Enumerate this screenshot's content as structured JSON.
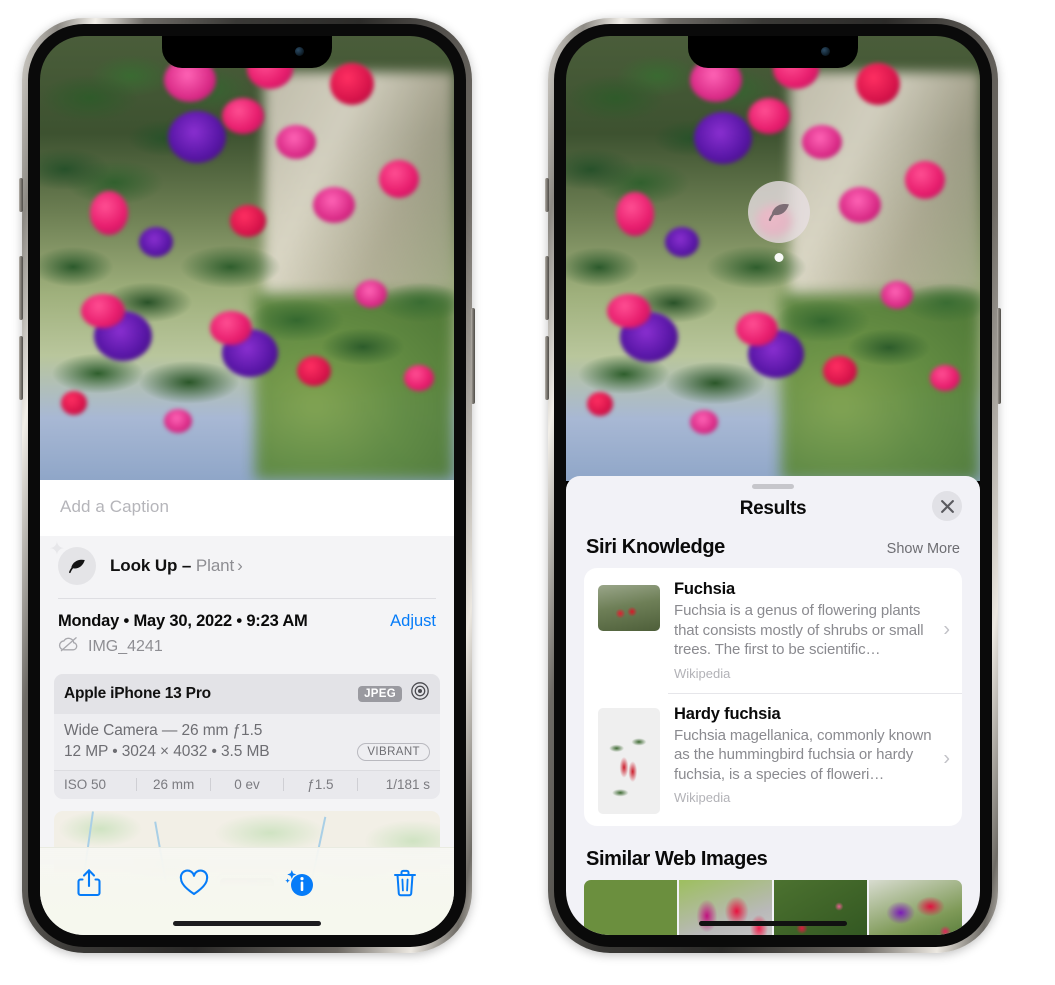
{
  "left_phone": {
    "caption_placeholder": "Add a Caption",
    "lookup": {
      "label": "Look Up –",
      "subject": "Plant",
      "chevron": "›",
      "icon": "leaf-icon"
    },
    "meta": {
      "date": "Monday • May 30, 2022 • 9:23 AM",
      "adjust_label": "Adjust",
      "filename": "IMG_4241",
      "cloud_icon": "cloud-slash-icon"
    },
    "exif": {
      "device": "Apple iPhone 13 Pro",
      "format_chip": "JPEG",
      "aperture_icon": "lens-icon",
      "lens_line": "Wide Camera — 26 mm ƒ1.5",
      "size_line": "12 MP • 3024 × 4032 • 3.5 MB",
      "style_chip": "VIBRANT",
      "stats": [
        "ISO 50",
        "26 mm",
        "0 ev",
        "ƒ1.5",
        "1/181 s"
      ]
    },
    "toolbar": [
      {
        "name": "share-button",
        "icon": "share-icon"
      },
      {
        "name": "favorite-button",
        "icon": "heart-icon"
      },
      {
        "name": "info-button",
        "icon": "info-sparkle-icon"
      },
      {
        "name": "delete-button",
        "icon": "trash-icon"
      }
    ]
  },
  "right_phone": {
    "bubble_icon": "leaf-icon",
    "sheet": {
      "title": "Results",
      "close_icon": "close-icon",
      "sections": [
        {
          "title": "Siri Knowledge",
          "action": "Show More",
          "items": [
            {
              "title": "Fuchsia",
              "desc": "Fuchsia is a genus of flowering plants that consists mostly of shrubs or small trees. The first to be scientific…",
              "source": "Wikipedia",
              "chevron": "›"
            },
            {
              "title": "Hardy fuchsia",
              "desc": "Fuchsia magellanica, commonly known as the hummingbird fuchsia or hardy fuchsia, is a species of floweri…",
              "source": "Wikipedia",
              "chevron": "›"
            }
          ]
        },
        {
          "title": "Similar Web Images",
          "thumbnails": [
            "web-image-1",
            "web-image-2",
            "web-image-3",
            "web-image-4"
          ]
        }
      ]
    }
  },
  "colors": {
    "accent_blue": "#067cf8",
    "sheet_bg": "#f2f2f7",
    "panel_bg": "#f4f4f6",
    "secondary_text": "#8e8e93"
  }
}
